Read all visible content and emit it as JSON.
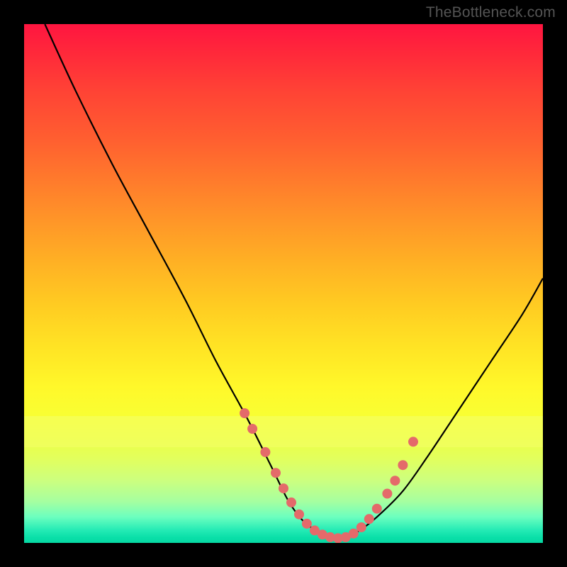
{
  "watermark": "TheBottleneck.com",
  "chart_data": {
    "type": "line",
    "title": "",
    "xlabel": "",
    "ylabel": "",
    "xlim": [
      0,
      100
    ],
    "ylim": [
      0,
      100
    ],
    "note": "Bottleneck-style V-curve. No numeric axes are drawn; values are read as percentages of the plot area (x = horizontal position, y = curve height from bottom).",
    "series": [
      {
        "name": "bottleneck-curve",
        "color": "#000000",
        "x": [
          4,
          10,
          17,
          24,
          31,
          37,
          43,
          48,
          51,
          54,
          57,
          59,
          61,
          64,
          68,
          73,
          78,
          84,
          90,
          96,
          100
        ],
        "y": [
          100,
          87,
          73,
          60,
          47,
          35,
          24,
          14,
          8,
          4,
          2,
          1,
          1,
          2,
          5,
          10,
          17,
          26,
          35,
          44,
          51
        ]
      }
    ],
    "markers": {
      "name": "highlight-dots",
      "color": "#e46a6a",
      "size": 7,
      "x": [
        42.5,
        44,
        46.5,
        48.5,
        50,
        51.5,
        53,
        54.5,
        56,
        57.5,
        59,
        60.5,
        62,
        63.5,
        65,
        66.5,
        68,
        70,
        71.5,
        73,
        75
      ],
      "y": [
        25,
        22,
        17.5,
        13.5,
        10.5,
        7.8,
        5.5,
        3.7,
        2.4,
        1.6,
        1.1,
        0.9,
        1.1,
        1.8,
        3,
        4.6,
        6.6,
        9.5,
        12,
        15,
        19.5
      ]
    },
    "gradient_bands": [
      {
        "y": 100,
        "color": "#ff1540"
      },
      {
        "y": 50,
        "color": "#ffcb22"
      },
      {
        "y": 18,
        "color": "#f4ff6a"
      },
      {
        "y": 0,
        "color": "#07d9a4"
      }
    ]
  }
}
